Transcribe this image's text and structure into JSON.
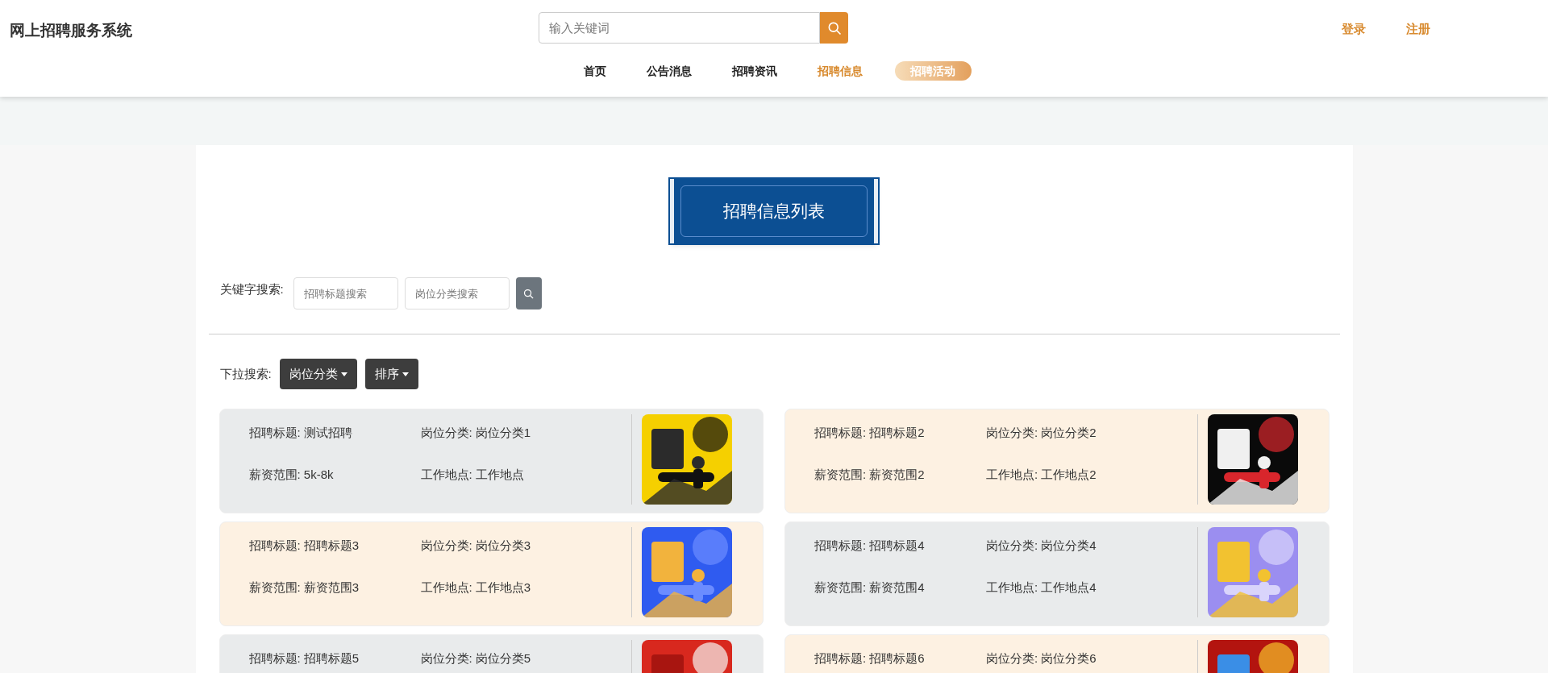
{
  "site_title": "网上招聘服务系统",
  "search": {
    "placeholder": "输入关键词"
  },
  "auth_links": [
    "登录",
    "注册"
  ],
  "nav": [
    {
      "label": "首页",
      "selected": false,
      "hover": false
    },
    {
      "label": "公告消息",
      "selected": false,
      "hover": false
    },
    {
      "label": "招聘资讯",
      "selected": false,
      "hover": false
    },
    {
      "label": "招聘信息",
      "selected": true,
      "hover": false
    },
    {
      "label": "招聘活动",
      "selected": false,
      "hover": true
    }
  ],
  "banner_title": "招聘信息列表",
  "keyword_search": {
    "label": "关键字搜索:",
    "fields": [
      {
        "placeholder": "招聘标题搜索"
      },
      {
        "placeholder": "岗位分类搜索"
      }
    ]
  },
  "dropdown_search": {
    "label": "下拉搜索:",
    "dropdowns": [
      "岗位分类",
      "排序"
    ]
  },
  "jobs": [
    {
      "fields": [
        "招聘标题: 测试招聘",
        "岗位分类: 岗位分类1",
        "薪资范围: 5k-8k",
        "工作地点: 工作地点"
      ],
      "image": {
        "kind": "picture"
      }
    },
    {
      "fields": [
        "招聘标题: 招聘标题2",
        "岗位分类: 岗位分类2",
        "薪资范围: 薪资范围2",
        "工作地点: 工作地点2"
      ],
      "image": {
        "kind": "picture"
      }
    },
    {
      "fields": [
        "招聘标题: 招聘标题3",
        "岗位分类: 岗位分类3",
        "薪资范围: 薪资范围3",
        "工作地点: 工作地点3"
      ],
      "image": {
        "kind": "picture"
      }
    },
    {
      "fields": [
        "招聘标题: 招聘标题4",
        "岗位分类: 岗位分类4",
        "薪资范围: 薪资范围4",
        "工作地点: 工作地点4"
      ],
      "image": {
        "kind": "picture"
      }
    },
    {
      "fields": [
        "招聘标题: 招聘标题5",
        "岗位分类: 岗位分类5"
      ],
      "image": {
        "kind": "picture"
      }
    },
    {
      "fields": [
        "招聘标题: 招聘标题6",
        "岗位分类: 岗位分类6"
      ],
      "image": {
        "kind": "picture"
      }
    }
  ]
}
